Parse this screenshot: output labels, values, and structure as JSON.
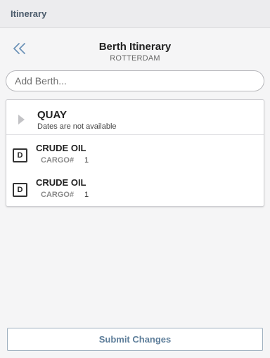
{
  "topbar": {
    "title": "Itinerary"
  },
  "header": {
    "back_icon": "double-chevron-left-icon",
    "title": "Berth Itinerary",
    "subtitle": "ROTTERDAM"
  },
  "add_berth": {
    "placeholder": "Add Berth...",
    "value": ""
  },
  "berth": {
    "name": "QUAY",
    "dates": "Dates are not available",
    "expand_icon": "triangle-right-icon",
    "cargoes": [
      {
        "badge": "D",
        "name": "CRUDE OIL",
        "cargo_label": "CARGO#",
        "cargo_number": "1"
      },
      {
        "badge": "D",
        "name": "CRUDE OIL",
        "cargo_label": "CARGO#",
        "cargo_number": "1"
      }
    ]
  },
  "footer": {
    "submit_label": "Submit Changes"
  },
  "colors": {
    "topbar_bg": "#ececee",
    "accent": "#5e7e9a",
    "back_icon": "#6d93b8"
  }
}
